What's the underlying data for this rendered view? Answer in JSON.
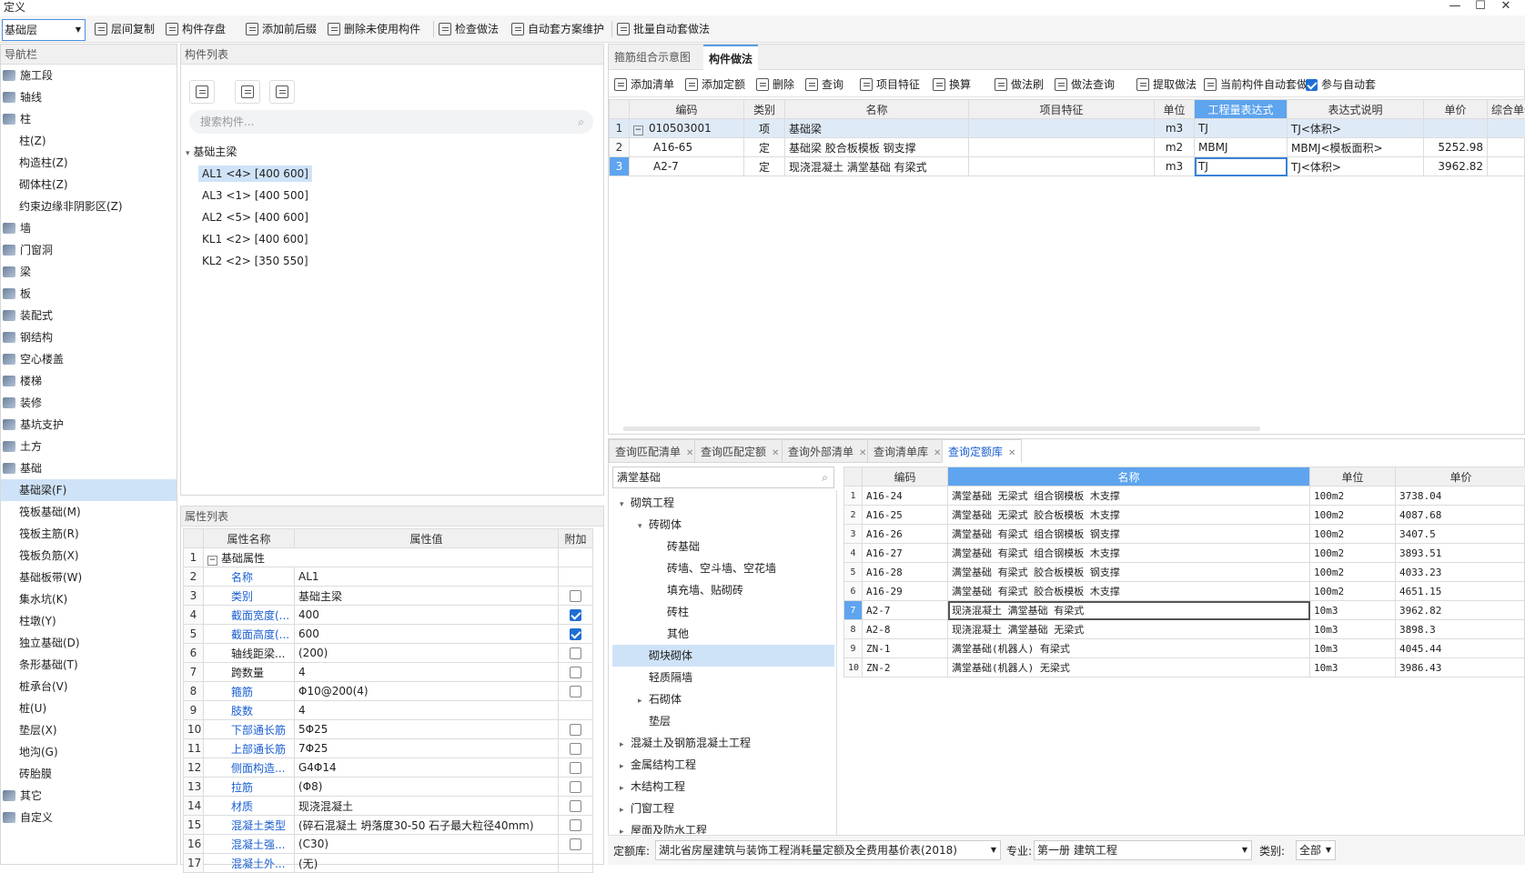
{
  "window": {
    "title": "定义",
    "min": "—",
    "max": "☐",
    "close": "✕"
  },
  "toolbar": {
    "layer": "基础层",
    "buttons": [
      "层间复制",
      "构件存盘",
      "添加前后缀",
      "删除未使用构件",
      "检查做法",
      "自动套方案维护",
      "批量自动套做法"
    ]
  },
  "nav": {
    "title": "导航栏",
    "items": [
      {
        "label": "施工段",
        "type": "cat"
      },
      {
        "label": "轴线",
        "type": "cat"
      },
      {
        "label": "柱",
        "type": "cat"
      },
      {
        "label": "柱(Z)",
        "type": "sub"
      },
      {
        "label": "构造柱(Z)",
        "type": "sub"
      },
      {
        "label": "砌体柱(Z)",
        "type": "sub"
      },
      {
        "label": "约束边缘非阴影区(Z)",
        "type": "sub"
      },
      {
        "label": "墙",
        "type": "cat"
      },
      {
        "label": "门窗洞",
        "type": "cat"
      },
      {
        "label": "梁",
        "type": "cat"
      },
      {
        "label": "板",
        "type": "cat"
      },
      {
        "label": "装配式",
        "type": "cat"
      },
      {
        "label": "钢结构",
        "type": "cat"
      },
      {
        "label": "空心楼盖",
        "type": "cat"
      },
      {
        "label": "楼梯",
        "type": "cat"
      },
      {
        "label": "装修",
        "type": "cat"
      },
      {
        "label": "基坑支护",
        "type": "cat"
      },
      {
        "label": "土方",
        "type": "cat"
      },
      {
        "label": "基础",
        "type": "cat"
      },
      {
        "label": "基础梁(F)",
        "type": "sub",
        "selected": true
      },
      {
        "label": "筏板基础(M)",
        "type": "sub"
      },
      {
        "label": "筏板主筋(R)",
        "type": "sub"
      },
      {
        "label": "筏板负筋(X)",
        "type": "sub"
      },
      {
        "label": "基础板带(W)",
        "type": "sub"
      },
      {
        "label": "集水坑(K)",
        "type": "sub"
      },
      {
        "label": "柱墩(Y)",
        "type": "sub"
      },
      {
        "label": "独立基础(D)",
        "type": "sub"
      },
      {
        "label": "条形基础(T)",
        "type": "sub"
      },
      {
        "label": "桩承台(V)",
        "type": "sub"
      },
      {
        "label": "桩(U)",
        "type": "sub"
      },
      {
        "label": "垫层(X)",
        "type": "sub"
      },
      {
        "label": "地沟(G)",
        "type": "sub"
      },
      {
        "label": "砖胎膜",
        "type": "sub"
      },
      {
        "label": "其它",
        "type": "cat"
      },
      {
        "label": "自定义",
        "type": "cat"
      }
    ]
  },
  "components": {
    "title": "构件列表",
    "search_placeholder": "搜索构件...",
    "group": "基础主梁",
    "items": [
      "AL1 <4> [400 600]",
      "AL3 <1> [400 500]",
      "AL2 <5> [400 600]",
      "KL1 <2> [400 600]",
      "KL2 <2> [350 550]"
    ]
  },
  "props": {
    "title": "属性列表",
    "headers": [
      "属性名称",
      "属性值",
      "附加"
    ],
    "rows": [
      {
        "n": "1",
        "name": "基础属性",
        "value": "",
        "cb": null,
        "group": true
      },
      {
        "n": "2",
        "name": "名称",
        "value": "AL1",
        "cb": null,
        "blue": true
      },
      {
        "n": "3",
        "name": "类别",
        "value": "基础主梁",
        "cb": false,
        "blue": true
      },
      {
        "n": "4",
        "name": "截面宽度(...",
        "value": "400",
        "cb": true,
        "blue": true
      },
      {
        "n": "5",
        "name": "截面高度(...",
        "value": "600",
        "cb": true,
        "blue": true
      },
      {
        "n": "6",
        "name": "轴线距梁...",
        "value": "(200)",
        "cb": false,
        "blue": false
      },
      {
        "n": "7",
        "name": "跨数量",
        "value": "4",
        "cb": false,
        "blue": false
      },
      {
        "n": "8",
        "name": "箍筋",
        "value": "Φ10@200(4)",
        "cb": false,
        "blue": true
      },
      {
        "n": "9",
        "name": "肢数",
        "value": "4",
        "cb": null,
        "blue": true
      },
      {
        "n": "10",
        "name": "下部通长筋",
        "value": "5Φ25",
        "cb": false,
        "blue": true
      },
      {
        "n": "11",
        "name": "上部通长筋",
        "value": "7Φ25",
        "cb": false,
        "blue": true
      },
      {
        "n": "12",
        "name": "侧面构造...",
        "value": "G4Φ14",
        "cb": false,
        "blue": true
      },
      {
        "n": "13",
        "name": "拉筋",
        "value": "(Φ8)",
        "cb": false,
        "blue": true
      },
      {
        "n": "14",
        "name": "材质",
        "value": "现浇混凝土",
        "cb": false,
        "blue": true
      },
      {
        "n": "15",
        "name": "混凝土类型",
        "value": "(碎石混凝土 坍落度30-50 石子最大粒径40mm)",
        "cb": false,
        "blue": true
      },
      {
        "n": "16",
        "name": "混凝土强...",
        "value": "(C30)",
        "cb": false,
        "blue": true
      },
      {
        "n": "17",
        "name": "混凝土外...",
        "value": "(无)",
        "cb": null,
        "blue": true
      }
    ]
  },
  "right": {
    "tabs": [
      "箍筋组合示意图",
      "构件做法"
    ],
    "tools": [
      "添加清单",
      "添加定额",
      "删除",
      "查询",
      "项目特征",
      "换算",
      "做法刷",
      "做法查询",
      "提取做法",
      "当前构件自动套做法",
      "参与自动套"
    ],
    "headers": [
      "编码",
      "类别",
      "名称",
      "项目特征",
      "单位",
      "工程量表达式",
      "表达式说明",
      "单价",
      "综合单价"
    ],
    "rows": [
      {
        "n": "1",
        "code": "010503001",
        "cat": "项",
        "name": "基础梁",
        "feature": "",
        "unit": "m3",
        "expr": "TJ",
        "desc": "TJ<体积>",
        "price": "",
        "sel": true
      },
      {
        "n": "2",
        "code": "A16-65",
        "cat": "定",
        "name": "基础梁 胶合板模板 钢支撑",
        "feature": "",
        "unit": "m2",
        "expr": "MBMJ",
        "desc": "MBMJ<模板面积>",
        "price": "5252.98"
      },
      {
        "n": "3",
        "code": "A2-7",
        "cat": "定",
        "name": "现浇混凝土 满堂基础 有梁式",
        "feature": "",
        "unit": "m3",
        "expr": "TJ",
        "desc": "TJ<体积>",
        "price": "3962.82"
      }
    ]
  },
  "lower": {
    "tabs": [
      "查询匹配清单",
      "查询匹配定额",
      "查询外部清单",
      "查询清单库",
      "查询定额库"
    ],
    "search": "满堂基础",
    "tree": [
      {
        "label": "砌筑工程",
        "lvl": 0,
        "arrow": "▾"
      },
      {
        "label": "砖砌体",
        "lvl": 1,
        "arrow": "▾"
      },
      {
        "label": "砖基础",
        "lvl": 2,
        "arrow": ""
      },
      {
        "label": "砖墙、空斗墙、空花墙",
        "lvl": 2,
        "arrow": ""
      },
      {
        "label": "填充墙、贴砌砖",
        "lvl": 2,
        "arrow": ""
      },
      {
        "label": "砖柱",
        "lvl": 2,
        "arrow": ""
      },
      {
        "label": "其他",
        "lvl": 2,
        "arrow": ""
      },
      {
        "label": "砌块砌体",
        "lvl": 1,
        "arrow": "",
        "sel": true
      },
      {
        "label": "轻质隔墙",
        "lvl": 1,
        "arrow": ""
      },
      {
        "label": "石砌体",
        "lvl": 1,
        "arrow": "▸"
      },
      {
        "label": "垫层",
        "lvl": 1,
        "arrow": ""
      },
      {
        "label": "混凝土及钢筋混凝土工程",
        "lvl": 0,
        "arrow": "▸"
      },
      {
        "label": "金属结构工程",
        "lvl": 0,
        "arrow": "▸"
      },
      {
        "label": "木结构工程",
        "lvl": 0,
        "arrow": "▸"
      },
      {
        "label": "门窗工程",
        "lvl": 0,
        "arrow": "▸"
      },
      {
        "label": "屋面及防水工程",
        "lvl": 0,
        "arrow": "▸"
      }
    ],
    "headers": [
      "编码",
      "名称",
      "单位",
      "单价"
    ],
    "rows": [
      {
        "n": "1",
        "code": "A16-24",
        "name": "满堂基础 无梁式 组合钢模板 木支撑",
        "unit": "100m2",
        "price": "3738.04"
      },
      {
        "n": "2",
        "code": "A16-25",
        "name": "满堂基础 无梁式 胶合板模板 木支撑",
        "unit": "100m2",
        "price": "4087.68"
      },
      {
        "n": "3",
        "code": "A16-26",
        "name": "满堂基础 有梁式 组合钢模板 钢支撑",
        "unit": "100m2",
        "price": "3407.5"
      },
      {
        "n": "4",
        "code": "A16-27",
        "name": "满堂基础 有梁式 组合钢模板 木支撑",
        "unit": "100m2",
        "price": "3893.51"
      },
      {
        "n": "5",
        "code": "A16-28",
        "name": "满堂基础 有梁式 胶合板模板 钢支撑",
        "unit": "100m2",
        "price": "4033.23"
      },
      {
        "n": "6",
        "code": "A16-29",
        "name": "满堂基础 有梁式 胶合板模板 木支撑",
        "unit": "100m2",
        "price": "4651.15"
      },
      {
        "n": "7",
        "code": "A2-7",
        "name": "现浇混凝土 满堂基础 有梁式",
        "unit": "10m3",
        "price": "3962.82",
        "sel": true
      },
      {
        "n": "8",
        "code": "A2-8",
        "name": "现浇混凝土 满堂基础 无梁式",
        "unit": "10m3",
        "price": "3898.3"
      },
      {
        "n": "9",
        "code": "ZN-1",
        "name": "满堂基础(机器人) 有梁式",
        "unit": "10m3",
        "price": "4045.44"
      },
      {
        "n": "10",
        "code": "ZN-2",
        "name": "满堂基础(机器人) 无梁式",
        "unit": "10m3",
        "price": "3986.43"
      }
    ],
    "status": {
      "lib_label": "定额库:",
      "lib": "湖北省房屋建筑与装饰工程消耗量定额及全费用基价表(2018)",
      "major_label": "专业:",
      "major": "第一册 建筑工程",
      "type_label": "类别:",
      "type": "全部"
    }
  }
}
